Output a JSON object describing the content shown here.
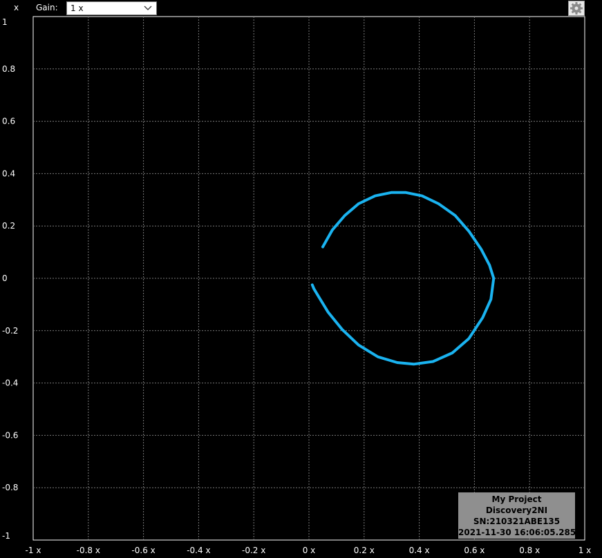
{
  "toolbar": {
    "channel_label": "x",
    "gain_label": "Gain:",
    "gain_value": "1 x",
    "settings_icon": "gear-icon",
    "chevron_icon": "chevron-down-icon"
  },
  "info_box": {
    "project": "My Project",
    "device": "Discovery2NI",
    "serial": "SN:210321ABE135",
    "timestamp": "2021-11-30 16:06:05.285"
  },
  "chart_data": {
    "type": "line",
    "title": "",
    "xlabel": "",
    "ylabel": "",
    "xlim": [
      -1,
      1
    ],
    "ylim": [
      -1,
      1
    ],
    "grid": true,
    "x_ticks": [
      "-1 x",
      "-0.8 x",
      "-0.6 x",
      "-0.4 x",
      "-0.2 x",
      "0 x",
      "0.2 x",
      "0.4 x",
      "0.6 x",
      "0.8 x",
      "1 x"
    ],
    "y_ticks": [
      "1",
      "0.8",
      "0.6",
      "0.4",
      "0.2",
      "0",
      "-0.2",
      "-0.4",
      "-0.6",
      "-0.8",
      "-1"
    ],
    "series": [
      {
        "color": "#1ab3f0",
        "x": [
          0.05,
          0.085,
          0.13,
          0.18,
          0.24,
          0.3,
          0.35,
          0.41,
          0.47,
          0.53,
          0.58,
          0.625,
          0.655,
          0.67,
          0.66,
          0.63,
          0.58,
          0.52,
          0.45,
          0.38,
          0.32,
          0.25,
          0.18,
          0.12,
          0.07,
          0.035,
          0.018,
          0.012
        ],
        "y": [
          0.12,
          0.185,
          0.24,
          0.285,
          0.315,
          0.328,
          0.328,
          0.315,
          0.285,
          0.24,
          0.18,
          0.11,
          0.05,
          0.0,
          -0.08,
          -0.15,
          -0.23,
          -0.285,
          -0.318,
          -0.328,
          -0.322,
          -0.3,
          -0.255,
          -0.195,
          -0.13,
          -0.07,
          -0.04,
          -0.025
        ]
      }
    ]
  }
}
